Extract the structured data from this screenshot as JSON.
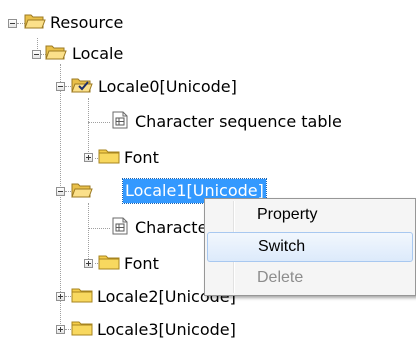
{
  "tree": {
    "root": {
      "label": "Resource",
      "icon": "open-folder-icon"
    },
    "locale": {
      "label": "Locale",
      "icon": "open-folder-icon"
    },
    "locale0": {
      "label": "Locale0[Unicode]",
      "icon": "open-folder-check-icon"
    },
    "locale0_charseq": {
      "label": "Character sequence table",
      "icon": "table-doc-icon"
    },
    "locale0_font": {
      "label": "Font",
      "icon": "folder-icon"
    },
    "locale1": {
      "label": "Locale1[Unicode]",
      "icon": "open-folder-icon",
      "selected": true
    },
    "locale1_charseq": {
      "label": "Character sequence table",
      "icon": "table-doc-icon"
    },
    "locale1_font": {
      "label": "Font",
      "icon": "folder-icon"
    },
    "locale2": {
      "label": "Locale2[Unicode]",
      "icon": "folder-icon"
    },
    "locale3": {
      "label": "Locale3[Unicode]",
      "icon": "folder-icon"
    }
  },
  "context_menu": {
    "items": [
      {
        "label": "Property",
        "state": "normal"
      },
      {
        "label": "Switch",
        "state": "hover"
      },
      {
        "label": "Delete",
        "state": "disabled"
      }
    ]
  },
  "colors": {
    "selection": "#3399ff",
    "folder": "#f5cd4a",
    "hover_border": "#a8c8f0"
  }
}
